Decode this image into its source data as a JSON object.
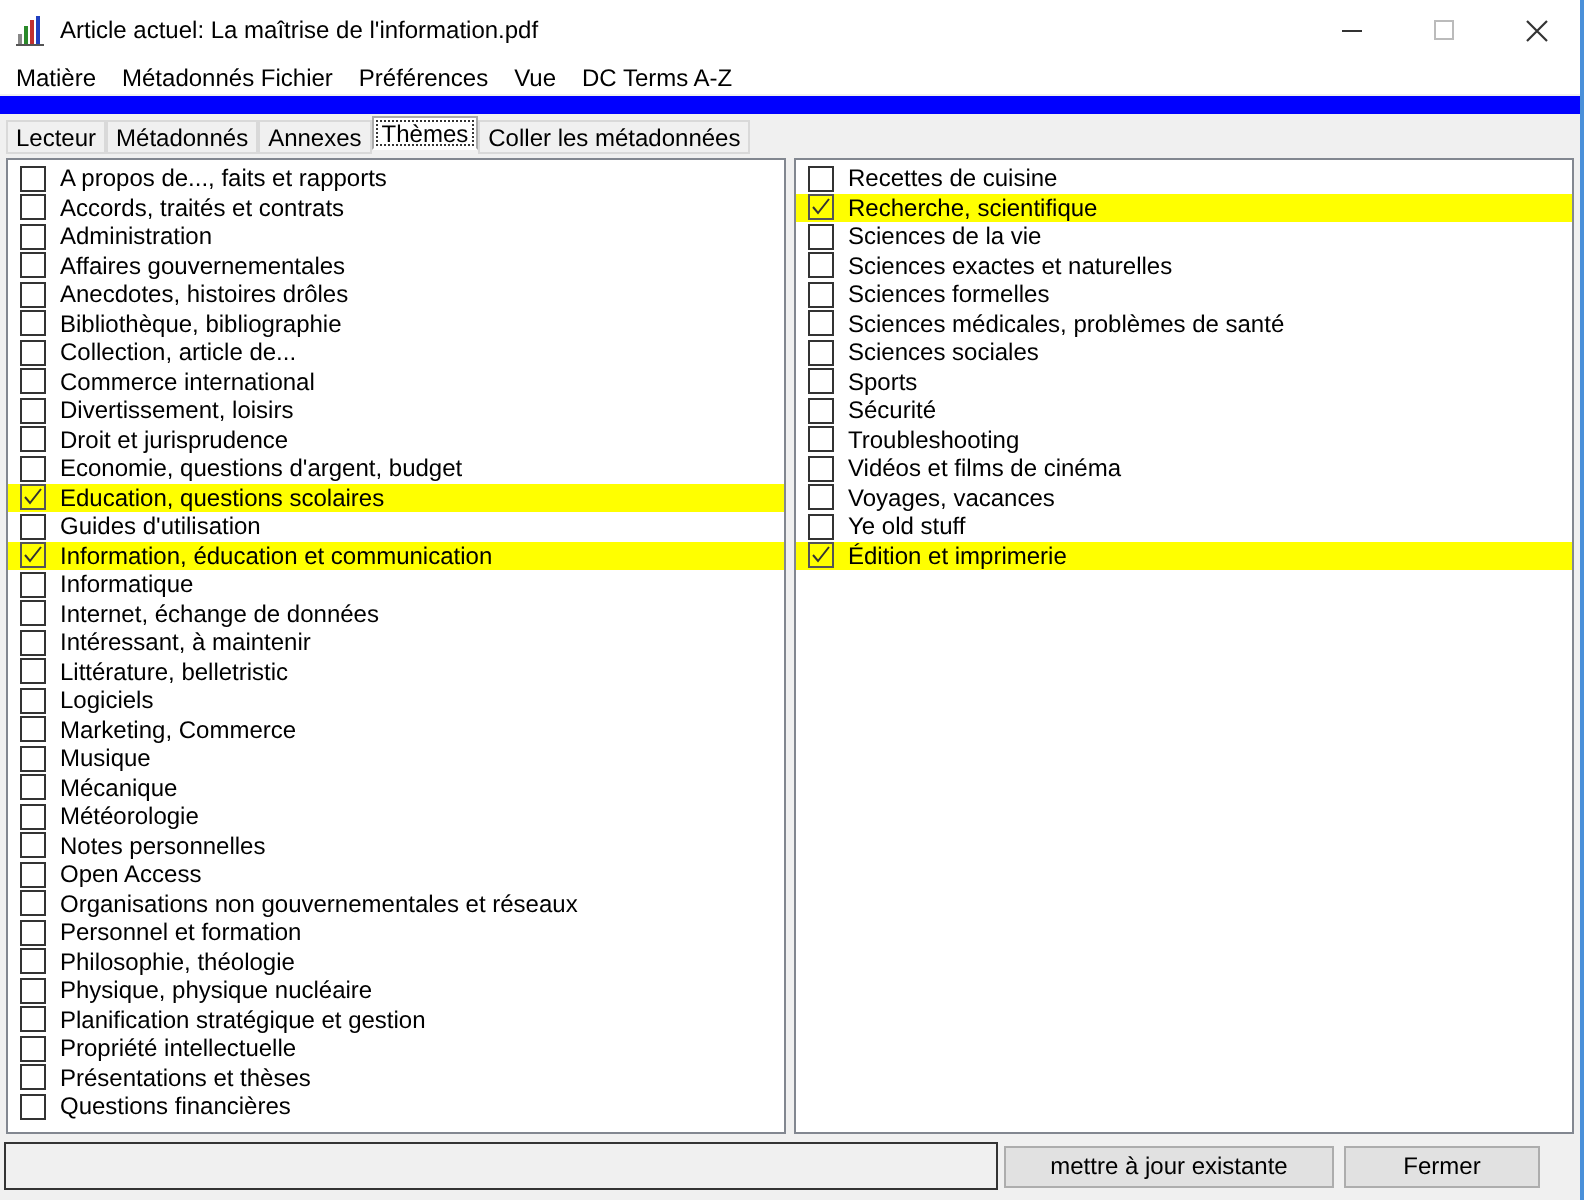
{
  "window": {
    "title": "Article actuel: La maîtrise de l'information.pdf"
  },
  "menu": [
    "Matière",
    "Métadonnés Fichier",
    "Préférences",
    "Vue",
    "DC Terms A-Z"
  ],
  "progress": {
    "level": 1
  },
  "tabs": [
    {
      "label": "Lecteur",
      "selected": false
    },
    {
      "label": "Métadonnés",
      "selected": false
    },
    {
      "label": "Annexes",
      "selected": false
    },
    {
      "label": "Thèmes",
      "selected": true
    },
    {
      "label": "Coller les métadonnées",
      "selected": false
    }
  ],
  "themes_left": [
    {
      "label": "A propos de..., faits et rapports",
      "checked": false
    },
    {
      "label": "Accords, traités et contrats",
      "checked": false
    },
    {
      "label": "Administration",
      "checked": false
    },
    {
      "label": "Affaires gouvernementales",
      "checked": false
    },
    {
      "label": "Anecdotes, histoires drôles",
      "checked": false
    },
    {
      "label": "Bibliothèque, bibliographie",
      "checked": false
    },
    {
      "label": "Collection, article de...",
      "checked": false
    },
    {
      "label": "Commerce international",
      "checked": false
    },
    {
      "label": "Divertissement, loisirs",
      "checked": false
    },
    {
      "label": "Droit et jurisprudence",
      "checked": false
    },
    {
      "label": "Economie, questions d'argent, budget",
      "checked": false
    },
    {
      "label": "Education, questions scolaires",
      "checked": true
    },
    {
      "label": "Guides d'utilisation",
      "checked": false
    },
    {
      "label": "Information, éducation et communication",
      "checked": true
    },
    {
      "label": "Informatique",
      "checked": false
    },
    {
      "label": "Internet, échange de données",
      "checked": false
    },
    {
      "label": "Intéressant, à maintenir",
      "checked": false
    },
    {
      "label": "Littérature, belletristic",
      "checked": false
    },
    {
      "label": "Logiciels",
      "checked": false
    },
    {
      "label": "Marketing, Commerce",
      "checked": false
    },
    {
      "label": "Musique",
      "checked": false
    },
    {
      "label": "Mécanique",
      "checked": false
    },
    {
      "label": "Météorologie",
      "checked": false
    },
    {
      "label": "Notes personnelles",
      "checked": false
    },
    {
      "label": "Open Access",
      "checked": false
    },
    {
      "label": "Organisations non gouvernementales et réseaux",
      "checked": false
    },
    {
      "label": "Personnel et formation",
      "checked": false
    },
    {
      "label": "Philosophie, théologie",
      "checked": false
    },
    {
      "label": "Physique, physique nucléaire",
      "checked": false
    },
    {
      "label": "Planification stratégique et gestion",
      "checked": false
    },
    {
      "label": "Propriété intellectuelle",
      "checked": false
    },
    {
      "label": "Présentations et thèses",
      "checked": false
    },
    {
      "label": "Questions financières",
      "checked": false
    }
  ],
  "themes_right": [
    {
      "label": "Recettes de cuisine",
      "checked": false
    },
    {
      "label": "Recherche, scientifique",
      "checked": true
    },
    {
      "label": "Sciences de la vie",
      "checked": false
    },
    {
      "label": "Sciences exactes et naturelles",
      "checked": false
    },
    {
      "label": "Sciences formelles",
      "checked": false
    },
    {
      "label": "Sciences médicales, problèmes de santé",
      "checked": false
    },
    {
      "label": "Sciences sociales",
      "checked": false
    },
    {
      "label": "Sports",
      "checked": false
    },
    {
      "label": "Sécurité",
      "checked": false
    },
    {
      "label": "Troubleshooting",
      "checked": false
    },
    {
      "label": "Vidéos et films de cinéma",
      "checked": false
    },
    {
      "label": "Voyages, vacances",
      "checked": false
    },
    {
      "label": "Ye old stuff",
      "checked": false
    },
    {
      "label": "Édition et imprimerie",
      "checked": true
    }
  ],
  "buttons": [
    "mettre à jour existante",
    "Fermer"
  ]
}
